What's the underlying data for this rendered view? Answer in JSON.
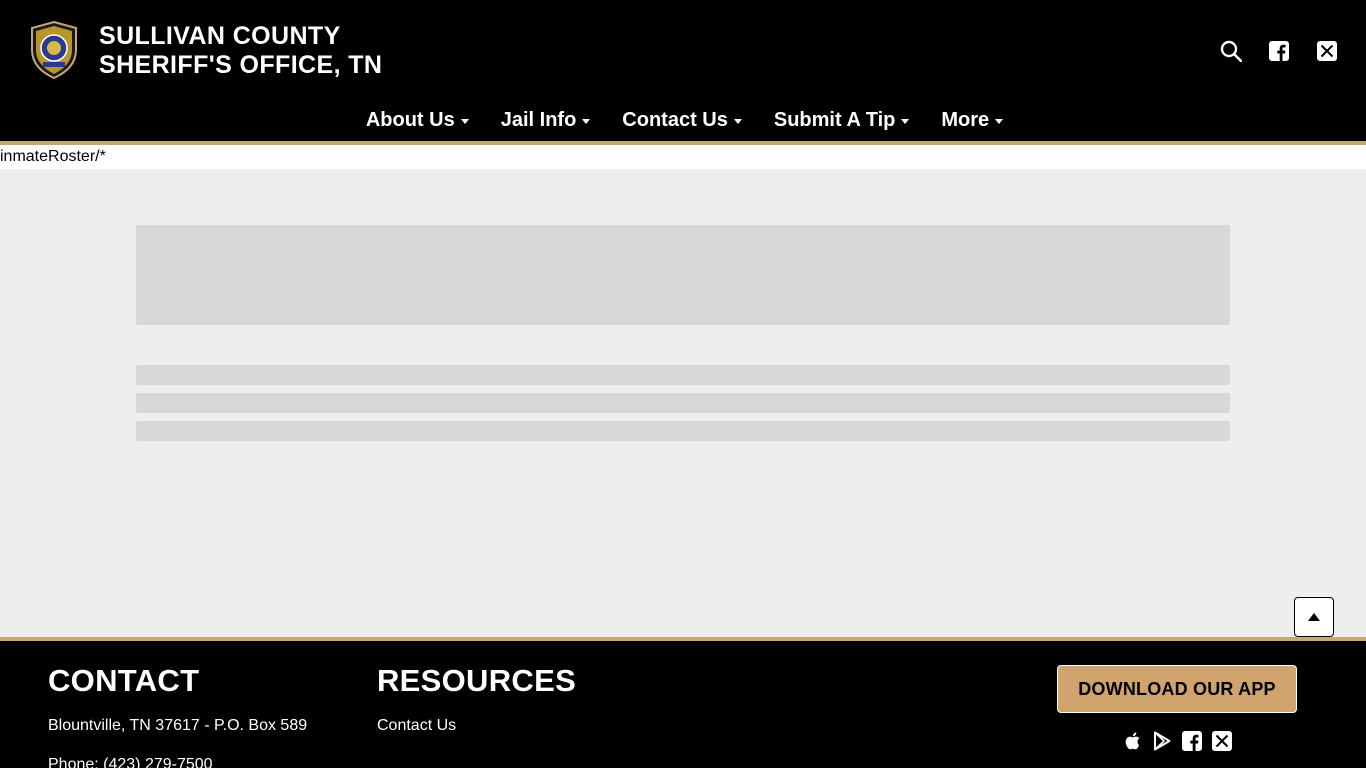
{
  "header": {
    "title_line1": "SULLIVAN COUNTY",
    "title_line2": "SHERIFF'S OFFICE, TN",
    "icons": [
      "search-icon",
      "facebook-icon",
      "x-twitter-icon"
    ]
  },
  "nav": {
    "items": [
      {
        "label": "About Us"
      },
      {
        "label": "Jail Info"
      },
      {
        "label": "Contact Us"
      },
      {
        "label": "Submit A Tip"
      },
      {
        "label": "More"
      }
    ]
  },
  "route": {
    "text": "inmateRoster/*"
  },
  "footer": {
    "contact_title": "CONTACT",
    "address": "Blountville, TN 37617 - P.O. Box 589",
    "phone": "Phone: (423) 279-7500",
    "resources_title": "RESOURCES",
    "resources_link": "Contact Us",
    "download_label": "DOWNLOAD OUR APP",
    "icons": [
      "apple-icon",
      "google-play-icon",
      "facebook-icon",
      "x-twitter-icon"
    ]
  },
  "colors": {
    "header_bg": "#000000",
    "accent": "#c7a77a",
    "download_btn": "#d0a46c",
    "skeleton": "#d8d8d8",
    "page_bg": "#eeeeee"
  }
}
